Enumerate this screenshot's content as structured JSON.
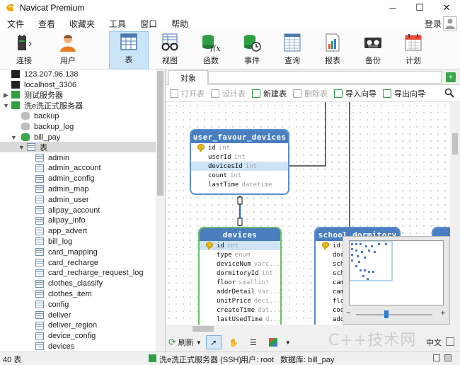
{
  "window": {
    "title": "Navicat Premium",
    "minimize": "─",
    "maximize": "☐",
    "close": "✕"
  },
  "menu": {
    "items": [
      "文件",
      "查看",
      "收藏夹",
      "工具",
      "窗口",
      "帮助"
    ],
    "login": "登录"
  },
  "toolbar": {
    "connect": "连接",
    "user": "用户",
    "table": "表",
    "view": "视图",
    "function": "函数",
    "event": "事件",
    "query": "查询",
    "report": "报表",
    "backup": "备份",
    "schedule": "计划"
  },
  "sidebar": {
    "items": [
      "123.207.96.138",
      "localhost_3306",
      "测试服务器",
      "洗e洗正式服务器",
      "backup",
      "backup_log",
      "bill_pay",
      "表"
    ],
    "tables": [
      "admin",
      "admin_account",
      "admin_config",
      "admin_map",
      "admin_user",
      "alipay_account",
      "alipay_info",
      "app_advert",
      "bill_log",
      "card_mapping",
      "card_recharge",
      "card_recharge_request_log",
      "clothes_classify",
      "clothes_item",
      "config",
      "deliver",
      "deliver_region",
      "device_config",
      "devices"
    ]
  },
  "tabs": {
    "objects": "对象"
  },
  "object_toolbar": {
    "open": "打开表",
    "design": "设计表",
    "new": "新建表",
    "delete": "删除表",
    "import": "导入向导",
    "export": "导出向导"
  },
  "entities": {
    "user_favour_devices": {
      "name": "user_favour_devices",
      "fields": [
        {
          "name": "id",
          "type": "int"
        },
        {
          "name": "userId",
          "type": "int"
        },
        {
          "name": "devicesId",
          "type": "int"
        },
        {
          "name": "count",
          "type": "int"
        },
        {
          "name": "lastTime",
          "type": "datetime"
        }
      ]
    },
    "devices": {
      "name": "devices",
      "fields": [
        {
          "name": "id",
          "type": "int"
        },
        {
          "name": "type",
          "type": "enum"
        },
        {
          "name": "deviceNum",
          "type": "varc..."
        },
        {
          "name": "dormitoryId",
          "type": "int"
        },
        {
          "name": "floor",
          "type": "smallint"
        },
        {
          "name": "addrDetail",
          "type": "var..."
        },
        {
          "name": "unitPrice",
          "type": "deci..."
        },
        {
          "name": "createTime",
          "type": "dat..."
        },
        {
          "name": "lastUsedTime",
          "type": "d..."
        }
      ]
    },
    "school_dormitory": {
      "name": "school_dormitory",
      "fields": [
        "id",
        "dor",
        "sch",
        "sch",
        "cam",
        "cam",
        "flo",
        "coo",
        "add"
      ]
    }
  },
  "bottom_toolbar": {
    "refresh": "刷新"
  },
  "status": {
    "count": "40 表",
    "connection": "洗e洗正式服务器 (SSH)",
    "user": "用户: root",
    "database": "数据库: bill_pay"
  },
  "watermark": "C++技术网",
  "colors": {
    "entity_header_blue": "#4a7ebf",
    "entity_header_green": "#5aa55a",
    "highlight_row": "#cfe3f6",
    "toolbar_active": "#cce4f7"
  }
}
